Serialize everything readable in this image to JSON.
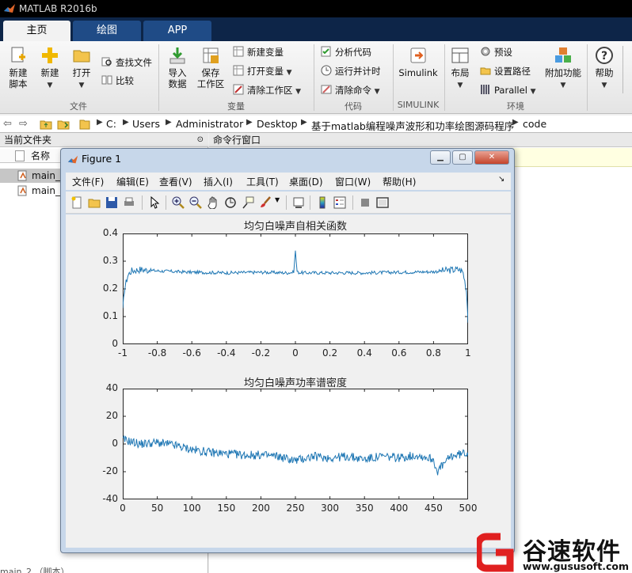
{
  "app": {
    "title": "MATLAB R2016b"
  },
  "tabs": [
    "主页",
    "绘图",
    "APP"
  ],
  "ribbon": {
    "file": {
      "new_script": "新建\n脚本",
      "new": "新建",
      "open": "打开",
      "find_files": "查找文件",
      "compare": "比较",
      "group_label": "文件"
    },
    "variable": {
      "import_data": "导入\n数据",
      "save_workspace": "保存\n工作区",
      "new_variable": "新建变量",
      "open_variable": "打开变量",
      "clear_workspace": "清除工作区",
      "group_label": "变量"
    },
    "code": {
      "analyze_code": "分析代码",
      "run_and_time": "运行并计时",
      "clear_commands": "清除命令",
      "group_label": "代码"
    },
    "simulink": {
      "button": "Simulink",
      "group_label": "SIMULINK"
    },
    "environment": {
      "layout": "布局",
      "preferences": "预设",
      "set_path": "设置路径",
      "parallel": "Parallel",
      "addons": "附加功能",
      "group_label": "环境"
    },
    "help": "帮助"
  },
  "address": {
    "crumbs": [
      "C:",
      "Users",
      "Administrator",
      "Desktop",
      "基于matlab编程噪声波形和功率绘图源码程序",
      "code"
    ]
  },
  "left_panel": {
    "title": "当前文件夹",
    "column": "名称",
    "files": [
      "main_",
      "main_"
    ]
  },
  "right_panel": {
    "title": "命令行窗口"
  },
  "figure": {
    "title": "Figure 1",
    "menus": [
      "文件(F)",
      "编辑(E)",
      "查看(V)",
      "插入(I)",
      "工具(T)",
      "桌面(D)",
      "窗口(W)",
      "帮助(H)"
    ]
  },
  "chart_data": [
    {
      "type": "line",
      "title": "均匀白噪声自相关函数",
      "xlabel": "",
      "ylabel": "",
      "xlim": [
        -1,
        1
      ],
      "ylim": [
        0,
        0.4
      ],
      "xticks": [
        "-1",
        "-0.8",
        "-0.6",
        "-0.4",
        "-0.2",
        "0",
        "0.2",
        "0.4",
        "0.6",
        "0.8",
        "1"
      ],
      "yticks": [
        "0",
        "0.1",
        "0.2",
        "0.3",
        "0.4"
      ],
      "color": "#1f77b4",
      "series": [
        {
          "x": [
            -1,
            -0.99,
            -0.97,
            -0.95,
            -0.9,
            -0.8,
            -0.6,
            -0.4,
            -0.2,
            -0.05,
            -0.01,
            0,
            0.01,
            0.05,
            0.2,
            0.4,
            0.6,
            0.8,
            0.9,
            0.95,
            0.97,
            0.99,
            1
          ],
          "y": [
            0.12,
            0.2,
            0.25,
            0.265,
            0.27,
            0.265,
            0.26,
            0.258,
            0.26,
            0.258,
            0.26,
            0.338,
            0.26,
            0.258,
            0.258,
            0.258,
            0.26,
            0.262,
            0.268,
            0.27,
            0.262,
            0.2,
            0.09
          ]
        }
      ]
    },
    {
      "type": "line",
      "title": "均匀白噪声功率谱密度",
      "xlabel": "",
      "ylabel": "",
      "xlim": [
        0,
        500
      ],
      "ylim": [
        -40,
        40
      ],
      "xticks": [
        "0",
        "50",
        "100",
        "150",
        "200",
        "250",
        "300",
        "350",
        "400",
        "450",
        "500"
      ],
      "yticks": [
        "-40",
        "-20",
        "0",
        "20",
        "40"
      ],
      "color": "#1f77b4",
      "series": [
        {
          "x": [
            0,
            10,
            25,
            50,
            75,
            100,
            125,
            150,
            175,
            200,
            225,
            250,
            275,
            300,
            325,
            350,
            375,
            400,
            425,
            450,
            455,
            475,
            500
          ],
          "y": [
            3,
            2,
            0,
            1,
            -1,
            -4,
            -6,
            -7,
            -8,
            -8,
            -9,
            -12,
            -9,
            -10,
            -9,
            -11,
            -9,
            -10,
            -8,
            -11,
            -20,
            -9,
            -6
          ]
        }
      ]
    }
  ],
  "watermark": {
    "name": "谷速软件",
    "url": "www.gususoft.com"
  },
  "bottom_fragment": "main_2  （脚本）"
}
